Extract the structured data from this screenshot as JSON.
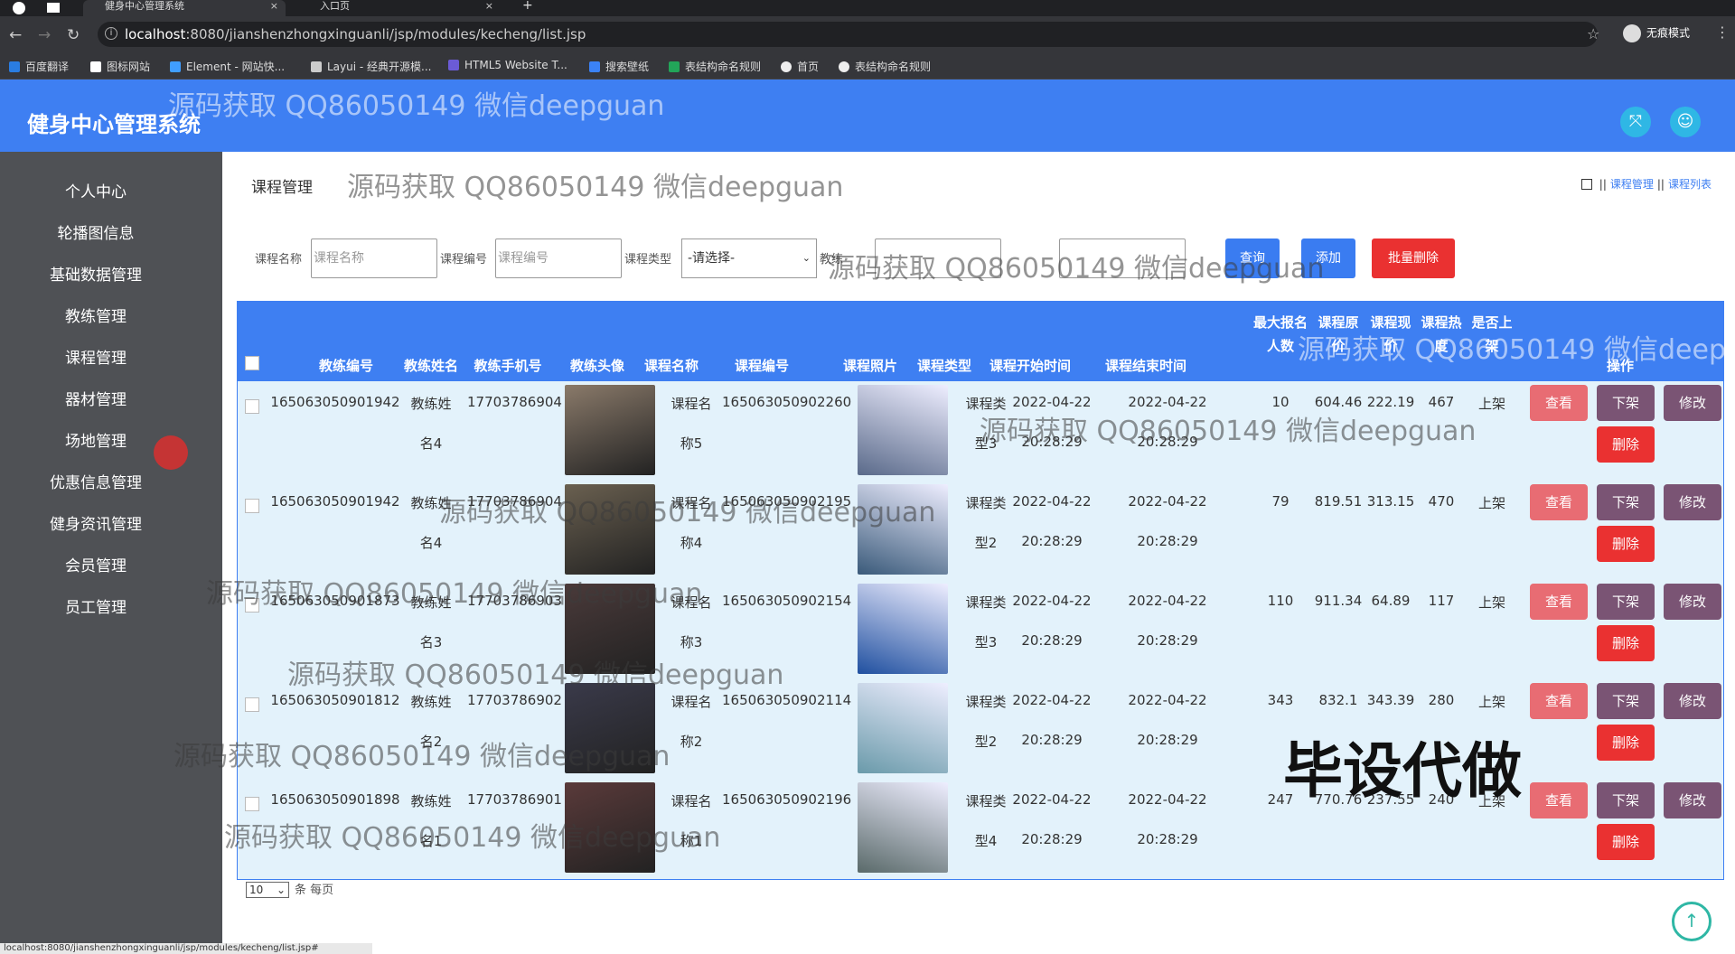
{
  "browser": {
    "tabs": [
      {
        "title": "健身中心管理系统",
        "active": true
      },
      {
        "title": "入口页",
        "active": false
      }
    ],
    "url_host": "localhost",
    "url_path": ":8080/jianshenzhongxinguanli/jsp/modules/kecheng/list.jsp",
    "incognito_label": "无痕模式",
    "bookmarks": [
      "百度翻译",
      "图标网站",
      "Element - 网站快...",
      "Layui - 经典开源模...",
      "HTML5 Website T...",
      "搜索壁纸",
      "表结构命名规则",
      "首页",
      "表结构命名规则"
    ],
    "status_url": "localhost:8080/jianshenzhongxinguanli/jsp/modules/kecheng/list.jsp#"
  },
  "header": {
    "app_title": "健身中心管理系统",
    "fullscreen_icon": "expand-icon",
    "user_icon": "user-icon"
  },
  "sidebar": {
    "items": [
      "个人中心",
      "轮播图信息",
      "基础数据管理",
      "教练管理",
      "课程管理",
      "器材管理",
      "场地管理",
      "优惠信息管理",
      "健身资讯管理",
      "会员管理",
      "员工管理"
    ]
  },
  "page": {
    "title": "课程管理",
    "breadcrumb": [
      "课程管理",
      "课程列表"
    ]
  },
  "filters": {
    "course_name_label": "课程名称",
    "course_name_placeholder": "课程名称",
    "course_code_label": "课程编号",
    "course_code_placeholder": "课程编号",
    "course_type_label": "课程类型",
    "course_type_value": "-请选择-",
    "coach_label": "教练",
    "search_button": "查询",
    "add_button": "添加",
    "batch_delete_button": "批量删除"
  },
  "table": {
    "headers": {
      "coach_no": "教练编号",
      "coach_name": "教练姓名",
      "coach_phone": "教练手机号",
      "coach_avatar": "教练头像",
      "course_name": "课程名称",
      "course_no": "课程编号",
      "course_photo": "课程照片",
      "course_type": "课程类型",
      "start_time": "课程开始时间",
      "end_time": "课程结束时间",
      "max_signup_1": "最大报名",
      "max_signup_2": "人数",
      "orig_price_1": "课程原",
      "orig_price_2": "价",
      "cur_price_1": "课程现",
      "cur_price_2": "价",
      "heat_1": "课程热",
      "heat_2": "度",
      "onshelf_1": "是否上",
      "onshelf_2": "架",
      "actions": "操作"
    },
    "rows": [
      {
        "coach_no": "165063050901942",
        "coach_name_1": "教练姓",
        "coach_name_2": "名4",
        "phone": "17703786904",
        "course_name_1": "课程名",
        "course_name_2": "称5",
        "course_no": "165063050902260",
        "type_1": "课程类",
        "type_2": "型3",
        "start_date": "2022-04-22",
        "start_time": "20:28:29",
        "end_date": "2022-04-22",
        "end_time": "20:28:29",
        "max": "10",
        "orig": "604.46",
        "cur": "222.19",
        "heat": "467",
        "onshelf": "上架"
      },
      {
        "coach_no": "165063050901942",
        "coach_name_1": "教练姓",
        "coach_name_2": "名4",
        "phone": "17703786904",
        "course_name_1": "课程名",
        "course_name_2": "称4",
        "course_no": "165063050902195",
        "type_1": "课程类",
        "type_2": "型2",
        "start_date": "2022-04-22",
        "start_time": "20:28:29",
        "end_date": "2022-04-22",
        "end_time": "20:28:29",
        "max": "79",
        "orig": "819.51",
        "cur": "313.15",
        "heat": "470",
        "onshelf": "上架"
      },
      {
        "coach_no": "165063050901873",
        "coach_name_1": "教练姓",
        "coach_name_2": "名3",
        "phone": "17703786903",
        "course_name_1": "课程名",
        "course_name_2": "称3",
        "course_no": "165063050902154",
        "type_1": "课程类",
        "type_2": "型3",
        "start_date": "2022-04-22",
        "start_time": "20:28:29",
        "end_date": "2022-04-22",
        "end_time": "20:28:29",
        "max": "110",
        "orig": "911.34",
        "cur": "64.89",
        "heat": "117",
        "onshelf": "上架"
      },
      {
        "coach_no": "165063050901812",
        "coach_name_1": "教练姓",
        "coach_name_2": "名2",
        "phone": "17703786902",
        "course_name_1": "课程名",
        "course_name_2": "称2",
        "course_no": "165063050902114",
        "type_1": "课程类",
        "type_2": "型2",
        "start_date": "2022-04-22",
        "start_time": "20:28:29",
        "end_date": "2022-04-22",
        "end_time": "20:28:29",
        "max": "343",
        "orig": "832.1",
        "cur": "343.39",
        "heat": "280",
        "onshelf": "上架"
      },
      {
        "coach_no": "165063050901898",
        "coach_name_1": "教练姓",
        "coach_name_2": "名1",
        "phone": "17703786901",
        "course_name_1": "课程名",
        "course_name_2": "称1",
        "course_no": "165063050902196",
        "type_1": "课程类",
        "type_2": "型4",
        "start_date": "2022-04-22",
        "start_time": "20:28:29",
        "end_date": "2022-04-22",
        "end_time": "20:28:29",
        "max": "247",
        "orig": "770.76",
        "cur": "237.55",
        "heat": "240",
        "onshelf": "上架"
      }
    ],
    "row_actions": {
      "view": "查看",
      "off_shelf": "下架",
      "edit": "修改",
      "delete": "删除"
    }
  },
  "pager": {
    "page_size": "10",
    "suffix": "条 每页"
  },
  "overlays": {
    "watermark": "源码获取 QQ86050149 微信deepguan",
    "watermark_partial": "源码获取 QQ86050149 微信deepg",
    "stamp": "毕设代做"
  },
  "colors": {
    "header_blue": "#3e7ff2",
    "sidebar": "#4f5155",
    "table_bg": "#e3f2fb",
    "view_btn": "#e86c73",
    "shelf_btn": "#7a5474",
    "delete_btn": "#ea3131"
  }
}
